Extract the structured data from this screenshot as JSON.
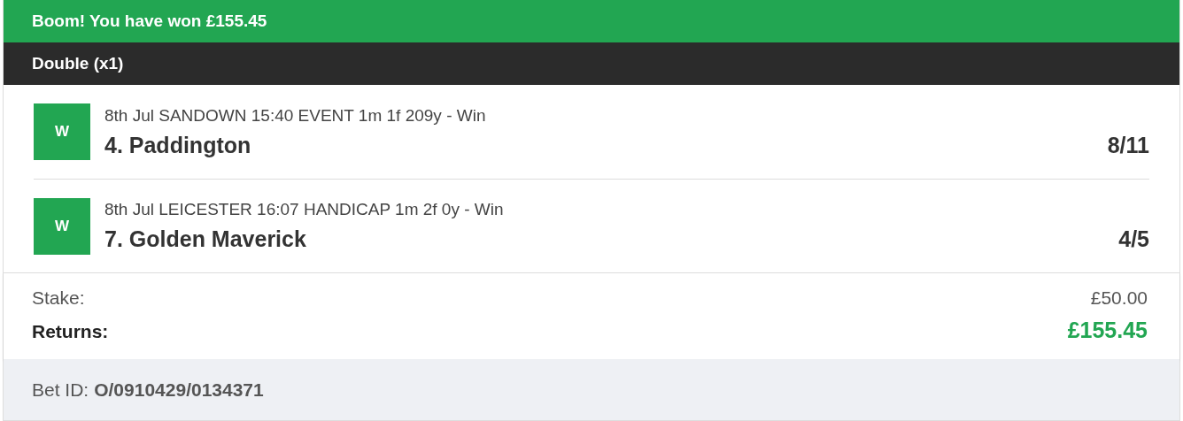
{
  "banner": {
    "title": "Boom! You have won £155.45"
  },
  "bet_header": {
    "title": "Double (x1)"
  },
  "legs": [
    {
      "result": "W",
      "event": "8th Jul SANDOWN 15:40 EVENT 1m 1f 209y - Win",
      "selection": "4. Paddington",
      "odds": "8/11"
    },
    {
      "result": "W",
      "event": "8th Jul LEICESTER 16:07 HANDICAP 1m 2f 0y - Win",
      "selection": "7. Golden Maverick",
      "odds": "4/5"
    }
  ],
  "summary": {
    "stake_label": "Stake:",
    "stake": "£50.00",
    "returns_label": "Returns:",
    "returns": "£155.45"
  },
  "footer": {
    "bet_id_label": "Bet ID:",
    "bet_id": "O/0910429/0134371"
  }
}
